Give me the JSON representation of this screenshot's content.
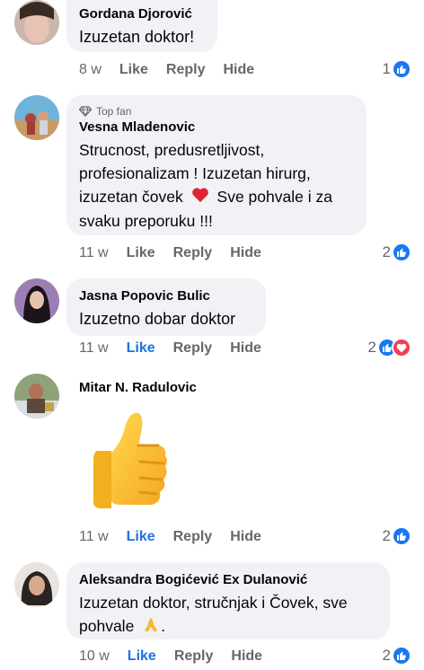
{
  "comments": [
    {
      "author": "Gordana Djorović",
      "text": "Izuzetan doktor!",
      "time": "8 w",
      "like": "Like",
      "reply": "Reply",
      "hide": "Hide",
      "reactions": "1",
      "liked": false
    },
    {
      "badge": "Top fan",
      "author": "Vesna Mladenovic",
      "text_lines": [
        "Strucnost, predusretljivost,",
        "profesionalizam ! Izuzetan hirurg,",
        "izuzetan čovek",
        "Sve pohvale i za",
        "svaku preporuku !!!"
      ],
      "time": "11 w",
      "like": "Like",
      "reply": "Reply",
      "hide": "Hide",
      "reactions": "2",
      "liked": false
    },
    {
      "author": "Jasna Popovic Bulic",
      "text": "Izuzetno dobar doktor",
      "time": "11 w",
      "like": "Like",
      "reply": "Reply",
      "hide": "Hide",
      "reactions": "2",
      "liked": true
    },
    {
      "author": "Mitar N. Radulovic",
      "time": "11 w",
      "like": "Like",
      "reply": "Reply",
      "hide": "Hide",
      "reactions": "2",
      "liked": true
    },
    {
      "author": "Aleksandra Bogićević Ex Dulanović",
      "text_lines": [
        "Izuzetan doktor, stručnjak i Čovek, sve",
        "pohvale",
        "."
      ],
      "time": "10 w",
      "like": "Like",
      "reply": "Reply",
      "hide": "Hide",
      "reactions": "2",
      "liked": true
    }
  ],
  "colors": {
    "bubble": "#f0f2f5",
    "like_active": "#1b74e4",
    "meta": "#65676b",
    "like_reaction": "#1877f2",
    "love_reaction": "#f33e58"
  },
  "icons": [
    "diamond-icon",
    "heart-emoji",
    "thumbs-up-emoji",
    "praying-hands-emoji",
    "like-reaction-icon",
    "love-reaction-icon"
  ]
}
